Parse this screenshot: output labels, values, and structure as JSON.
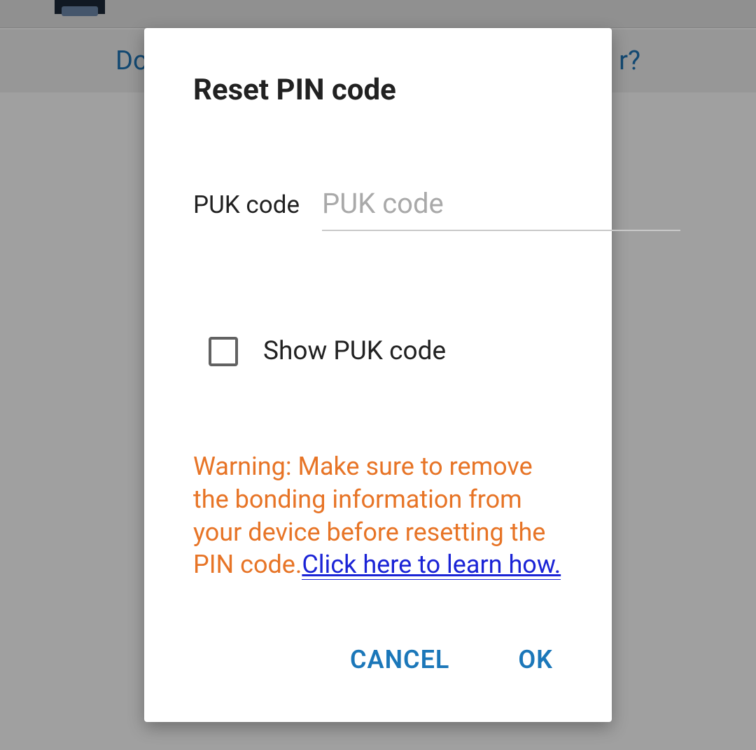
{
  "background": {
    "link_left_fragment": "Do",
    "link_right_fragment": "r?"
  },
  "dialog": {
    "title": "Reset PIN code",
    "puk_label": "PUK code",
    "puk_placeholder": "PUK code",
    "puk_value": "",
    "show_puk_label": "Show PUK code",
    "warning_text": "Warning: Make sure to remove the bonding information from your device before resetting the PIN code.",
    "warning_link": "Click here to learn how.",
    "cancel_label": "CANCEL",
    "ok_label": "OK"
  }
}
